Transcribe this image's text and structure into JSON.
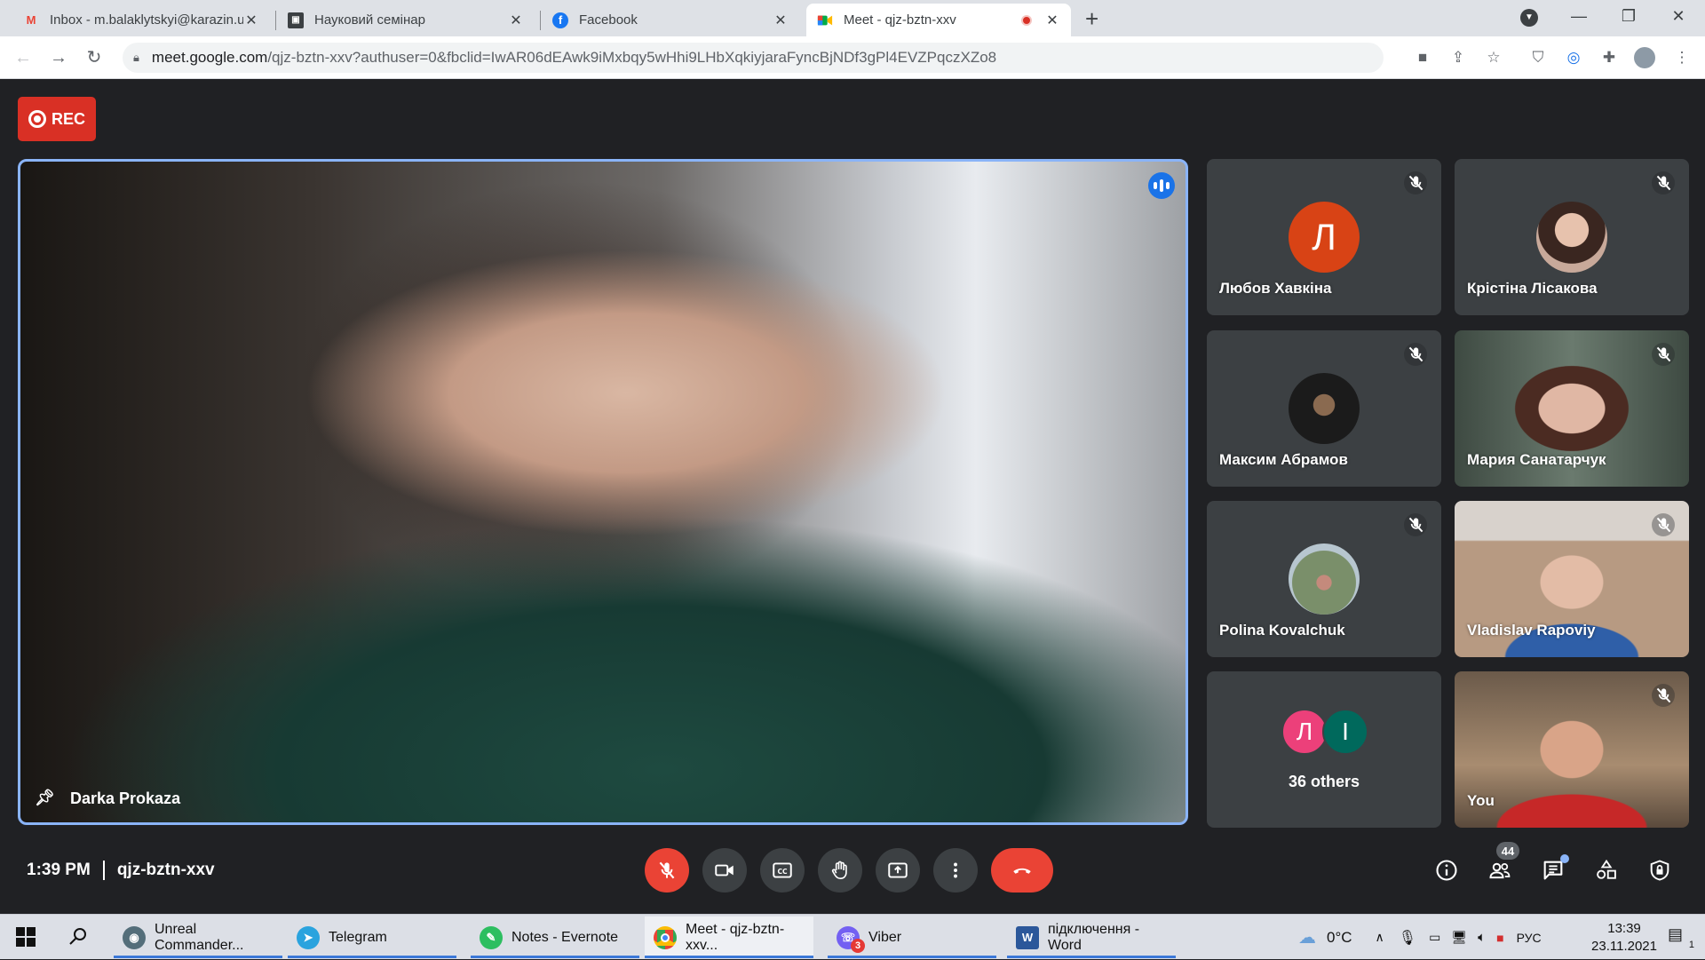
{
  "browser": {
    "tabs": [
      {
        "title": "Inbox - m.balaklytskyi@karazin.u",
        "icon": "gmail-icon",
        "active": false
      },
      {
        "title": "Науковий семінар",
        "icon": "classroom-icon",
        "active": false
      },
      {
        "title": "Facebook",
        "icon": "facebook-icon",
        "active": false
      },
      {
        "title": "Meet - qjz-bztn-xxv",
        "icon": "meet-icon",
        "active": true
      }
    ],
    "new_tab_glyph": "+",
    "url_host": "meet.google.com",
    "url_path": "/qjz-bztn-xxv?authuser=0&fbclid=IwAR06dEAwk9iMxbqy5wHhi9LHbXqkiyjaraFyncBjNDf3gPl4EVZPqczXZo8"
  },
  "meet": {
    "rec_label": "REC",
    "main_speaker": "Darka Prokaza",
    "tiles": [
      {
        "name": "Любов Хавкіна",
        "type": "letter",
        "letter": "Л",
        "color": "#d84315"
      },
      {
        "name": "Крістіна Лісакова",
        "type": "photo"
      },
      {
        "name": "Максим Абрамов",
        "type": "photo"
      },
      {
        "name": "Мария Санатарчук",
        "type": "video"
      },
      {
        "name": "Polina Kovalchuk",
        "type": "photo"
      },
      {
        "name": "Vladislav Rapoviy",
        "type": "video"
      },
      {
        "name": "You",
        "type": "video"
      }
    ],
    "others": {
      "label": "36 others",
      "letters": [
        "Л",
        "І"
      ],
      "colors": [
        "#ec407a",
        "#00695c"
      ]
    },
    "time": "1:39 PM",
    "meeting_code": "qjz-bztn-xxv",
    "participant_count": "44",
    "colors": {
      "end_call": "#ea4335",
      "mic_off": "#ea4335",
      "active_border": "#8ab4f8",
      "rec": "#d93025"
    }
  },
  "taskbar": {
    "items": [
      {
        "label": "Unreal Commander...",
        "icon": "unreal-commander-icon"
      },
      {
        "label": "Telegram",
        "icon": "telegram-icon"
      },
      {
        "label": "Notes - Evernote",
        "icon": "evernote-icon"
      },
      {
        "label": "Meet - qjz-bztn-xxv...",
        "icon": "chrome-icon"
      },
      {
        "label": "Viber",
        "icon": "viber-icon",
        "badge": "3"
      },
      {
        "label": "підключення - Word",
        "icon": "word-icon"
      }
    ],
    "temperature": "0°C",
    "language": "РУС",
    "clock_time": "13:39",
    "clock_date": "23.11.2021",
    "notification_count": "1"
  }
}
